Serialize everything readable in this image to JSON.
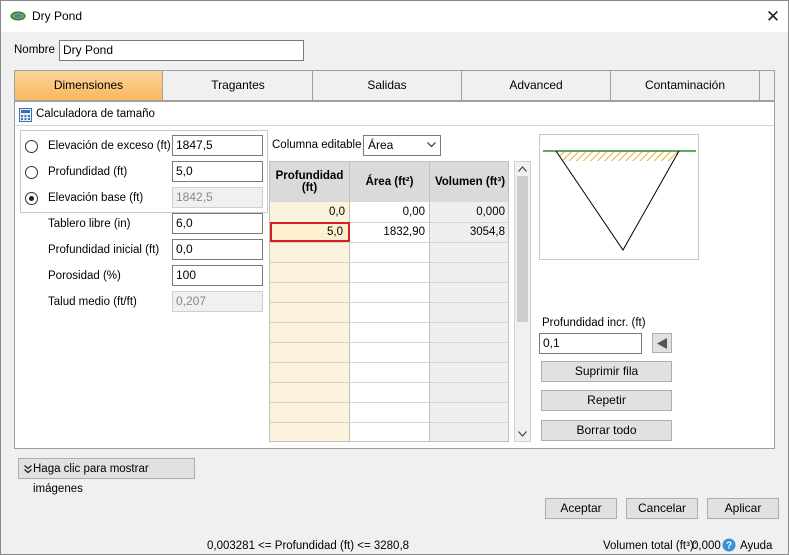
{
  "window": {
    "title": "Dry Pond",
    "close_label": "✕"
  },
  "name_field": {
    "label": "Nombre",
    "value": "Dry Pond"
  },
  "tabs": [
    {
      "label": "Dimensiones",
      "active": true
    },
    {
      "label": "Tragantes",
      "active": false
    },
    {
      "label": "Salidas",
      "active": false
    },
    {
      "label": "Advanced",
      "active": false
    },
    {
      "label": "Contaminación",
      "active": false
    }
  ],
  "calculator": {
    "title": "Calculadora de tamaño"
  },
  "radio_fields": [
    {
      "label": "Elevación de exceso (ft)",
      "value": "1847,5",
      "selected": false,
      "disabled": false
    },
    {
      "label": "Profundidad (ft)",
      "value": "5,0",
      "selected": false,
      "disabled": false
    },
    {
      "label": "Elevación base (ft)",
      "value": "1842,5",
      "selected": true,
      "disabled": true
    }
  ],
  "fields": [
    {
      "label": "Tablero libre (in)",
      "value": "6,0",
      "disabled": false
    },
    {
      "label": "Profundidad inicial (ft)",
      "value": "0,0",
      "disabled": false
    },
    {
      "label": "Porosidad (%)",
      "value": "100",
      "disabled": false
    },
    {
      "label": "Talud medio (ft/ft)",
      "value": "0,207",
      "disabled": true
    }
  ],
  "editable_column": {
    "label": "Columna editable",
    "value": "Área"
  },
  "table": {
    "headers": [
      "Profundidad (ft)",
      "Área (ft²)",
      "Volumen (ft³)"
    ],
    "rows": [
      [
        "0,0",
        "0,00",
        "0,000"
      ],
      [
        "5,0",
        "1832,90",
        "3054,8"
      ]
    ]
  },
  "depth_increment": {
    "label": "Profundidad incr. (ft)",
    "value": "0,1"
  },
  "side_buttons": {
    "delete_row": "Suprimir fila",
    "repeat": "Repetir",
    "clear_all": "Borrar todo"
  },
  "show_images": {
    "label": "Haga clic para mostrar imágenes"
  },
  "footer_buttons": {
    "accept": "Aceptar",
    "cancel": "Cancelar",
    "apply": "Aplicar"
  },
  "status": {
    "range_text": "0,003281 <= Profundidad (ft) <= 3280,8",
    "total_volume_label": "Volumen total (ft³):",
    "total_volume_value": "0,000",
    "help_label": "Ayuda"
  },
  "colors": {
    "active_tab": "#f8b85f",
    "selected_cell_bg": "#fdf0d0",
    "depth_column_bg": "#fdf3dc",
    "hatch": "#e8b030",
    "water_line": "#2e8b2e"
  },
  "icons": [
    "pond-icon",
    "close-icon",
    "calculator-icon",
    "chevron-down-icon",
    "scroll-up-icon",
    "scroll-down-icon",
    "arrow-left-icon",
    "double-chevron-down-icon",
    "help-icon"
  ]
}
